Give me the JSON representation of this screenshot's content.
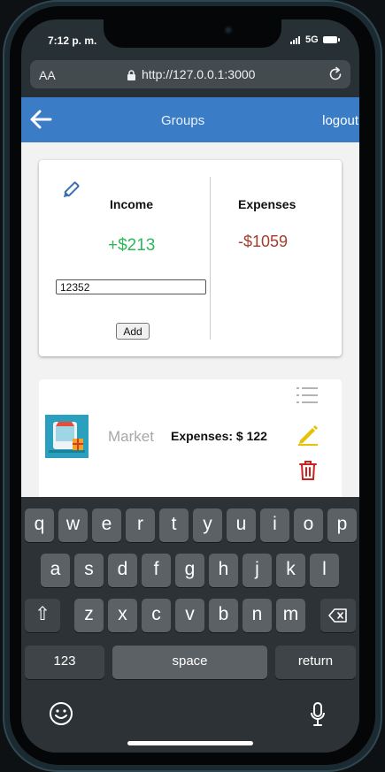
{
  "status": {
    "time": "7:12 p. m.",
    "network": "5G"
  },
  "browser": {
    "text_size": "AA",
    "url": "http://127.0.0.1:3000"
  },
  "app": {
    "title": "Groups",
    "logout": "logout",
    "summary": {
      "income_label": "Income",
      "income_value": "+$213",
      "expenses_label": "Expenses",
      "expenses_value": "-$1059",
      "input_value": "12352",
      "add_label": "Add"
    },
    "group": {
      "name": "Market",
      "expenses": "Expenses: $ 122"
    }
  },
  "keyboard": {
    "row1": [
      "q",
      "w",
      "e",
      "r",
      "t",
      "y",
      "u",
      "i",
      "o",
      "p"
    ],
    "row2": [
      "a",
      "s",
      "d",
      "f",
      "g",
      "h",
      "j",
      "k",
      "l"
    ],
    "row3": [
      "z",
      "x",
      "c",
      "v",
      "b",
      "n",
      "m"
    ],
    "shift": "⇧",
    "numbers": "123",
    "space": "space",
    "return": "return"
  },
  "colors": {
    "appbar": "#3b7cc7",
    "income": "#2eb85c",
    "expenses": "#a23d2c",
    "edit_pencil": "#e6c300",
    "delete": "#cc1f1f"
  }
}
